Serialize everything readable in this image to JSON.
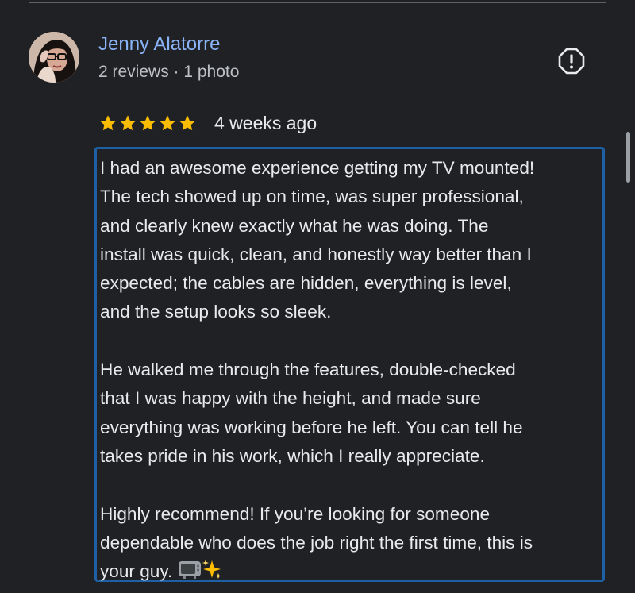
{
  "reviewer": {
    "name": "Jenny Alatorre",
    "meta": "2 reviews · 1 photo"
  },
  "review": {
    "rating": 5,
    "max_rating": 5,
    "date": "4 weeks ago",
    "paragraphs": [
      [
        "I had an awesome experience getting my TV mounted!",
        "The tech showed up on time, was super professional,",
        "and clearly knew exactly what he was doing. The",
        "install was quick, clean, and honestly way better than I",
        "expected; the cables are hidden, everything is level,",
        "and the setup looks so sleek."
      ],
      [
        "He walked me through the features, double-checked",
        "that I was happy with the height, and made sure",
        "everything was working before he left. You can tell he",
        "takes pride in his work, which I really appreciate."
      ],
      [
        "Highly recommend! If you’re looking for someone",
        "dependable who does the job right the first time, this is",
        "your guy."
      ]
    ],
    "emojis": [
      "television-emoji",
      "sparkles-emoji"
    ]
  },
  "icons": {
    "report": "report-icon",
    "star": "star-icon"
  },
  "colors": {
    "background": "#202124",
    "name": "#8ab4f8",
    "star": "#fbbc04",
    "highlight_border": "#1f5fa3",
    "text": "#e8eaed",
    "secondary_text": "#bdc1c6"
  }
}
